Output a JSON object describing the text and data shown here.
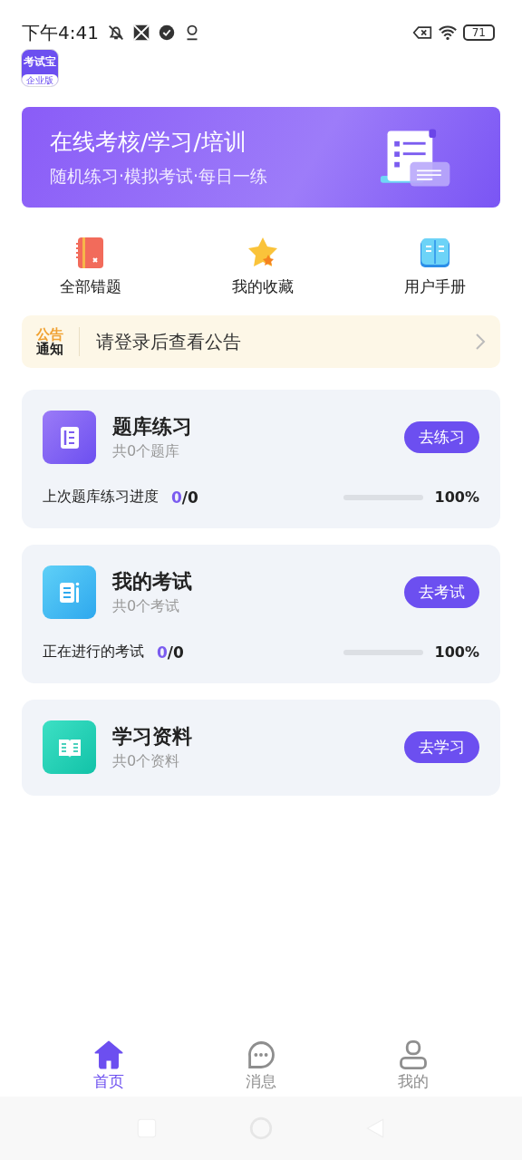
{
  "status_bar": {
    "time": "下午4:41",
    "battery": "71"
  },
  "logo": {
    "name": "考试宝",
    "edition": "企业版"
  },
  "banner": {
    "title": "在线考核/学习/培训",
    "subtitle": "随机练习·模拟考试·每日一练"
  },
  "shortcuts": [
    {
      "kind": "notebook",
      "label": "全部错题"
    },
    {
      "kind": "star",
      "label": "我的收藏"
    },
    {
      "kind": "book",
      "label": "用户手册"
    }
  ],
  "notice": {
    "badge_top": "公告",
    "badge_bottom": "通知",
    "text": "请登录后查看公告"
  },
  "cards": [
    {
      "kind": "bank",
      "title": "题库练习",
      "subtitle": "共0个题库",
      "button": "去练习",
      "progress": {
        "label": "上次题库练习进度",
        "done": "0",
        "rest": "/0",
        "level": 0,
        "percent": "100%"
      }
    },
    {
      "kind": "exam",
      "title": "我的考试",
      "subtitle": "共0个考试",
      "button": "去考试",
      "progress": {
        "label": "正在进行的考试",
        "done": "0",
        "rest": "/0",
        "level": 0,
        "percent": "100%"
      }
    },
    {
      "kind": "material",
      "title": "学习资料",
      "subtitle": "共0个资料",
      "button": "去学习"
    }
  ],
  "tab_bar": [
    {
      "kind": "home",
      "label": "首页",
      "selected": true
    },
    {
      "kind": "chat",
      "label": "消息",
      "selected": false
    },
    {
      "kind": "user",
      "label": "我的",
      "selected": false
    }
  ]
}
